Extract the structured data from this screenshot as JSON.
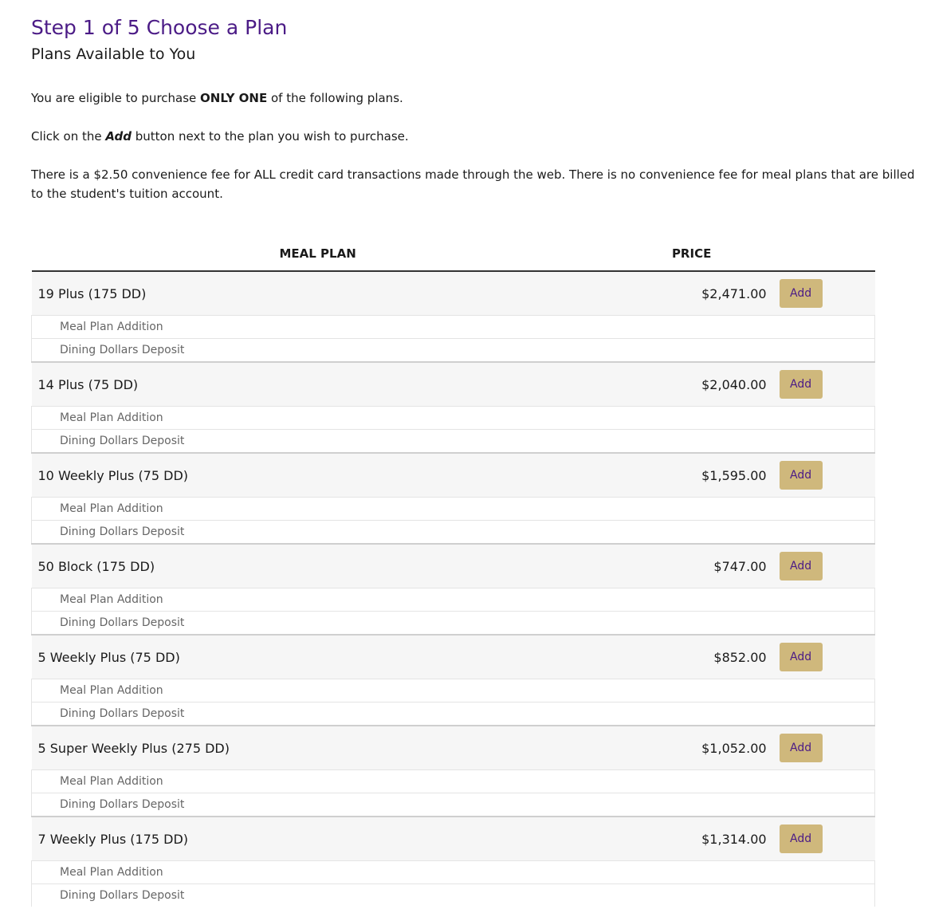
{
  "header": {
    "step_title": "Step 1 of 5 Choose a Plan",
    "subtitle": "Plans Available to You"
  },
  "instructions": {
    "eligible_prefix": "You are eligible to purchase ",
    "eligible_strong": "ONLY ONE",
    "eligible_suffix": " of the following plans.",
    "click_prefix": "Click on the ",
    "click_em": "Add",
    "click_suffix": " button next to the plan you wish to purchase.",
    "fee_text": "There is a $2.50 convenience fee for ALL credit card transactions made through the web. There is no convenience fee for meal plans that are billed to the student's tuition account."
  },
  "table": {
    "col_plan": "MEAL PLAN",
    "col_price": "PRICE",
    "add_label": "Add",
    "plans": [
      {
        "name": "19 Plus (175 DD)",
        "price": "$2,471.00",
        "sub1": "Meal Plan Addition",
        "sub2": "Dining Dollars Deposit"
      },
      {
        "name": "14 Plus (75 DD)",
        "price": "$2,040.00",
        "sub1": "Meal Plan Addition",
        "sub2": "Dining Dollars Deposit"
      },
      {
        "name": "10 Weekly Plus (75 DD)",
        "price": "$1,595.00",
        "sub1": "Meal Plan Addition",
        "sub2": "Dining Dollars Deposit"
      },
      {
        "name": "50 Block (175 DD)",
        "price": "$747.00",
        "sub1": "Meal Plan Addition",
        "sub2": "Dining Dollars Deposit"
      },
      {
        "name": "5 Weekly Plus (75 DD)",
        "price": "$852.00",
        "sub1": "Meal Plan Addition",
        "sub2": "Dining Dollars Deposit"
      },
      {
        "name": "5 Super Weekly Plus (275 DD)",
        "price": "$1,052.00",
        "sub1": "Meal Plan Addition",
        "sub2": "Dining Dollars Deposit"
      },
      {
        "name": "7 Weekly Plus (175 DD)",
        "price": "$1,314.00",
        "sub1": "Meal Plan Addition",
        "sub2": "Dining Dollars Deposit"
      }
    ]
  },
  "colors": {
    "title": "#4b1b86",
    "button_bg": "#cfb87c",
    "button_text": "#4b1b86",
    "row_bg": "#f6f6f6"
  }
}
